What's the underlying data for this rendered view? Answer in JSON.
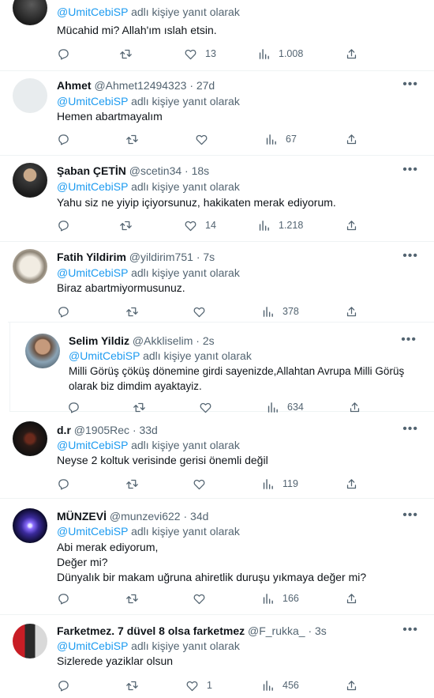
{
  "reply_prefix": "adlı kişiye yanıt olarak",
  "tweets": [
    {
      "name": "",
      "handle": "",
      "time": "",
      "mention": "@UmitCebiSP",
      "lines": [
        "Mücahid mi? Allah'ım ıslah etsin."
      ],
      "replies": "",
      "retweets": "",
      "likes": "13",
      "views": "1.008"
    },
    {
      "name": "Ahmet",
      "handle": "@Ahmet12494323",
      "time": "· 27d",
      "mention": "@UmitCebiSP",
      "lines": [
        "Hemen abartmayalım"
      ],
      "replies": "",
      "retweets": "",
      "likes": "",
      "views": "67"
    },
    {
      "name": "Şaban ÇETİN",
      "handle": "@scetin34",
      "time": "· 18s",
      "mention": "@UmitCebiSP",
      "lines": [
        "Yahu siz ne yiyip içiyorsunuz, hakikaten merak ediyorum."
      ],
      "replies": "",
      "retweets": "",
      "likes": "14",
      "views": "1.218"
    },
    {
      "name": "Fatih Yildirim",
      "handle": "@yildirim751",
      "time": "· 7s",
      "mention": "@UmitCebiSP",
      "lines": [
        "Biraz abartmiyormusunuz."
      ],
      "replies": "",
      "retweets": "",
      "likes": "",
      "views": "378"
    },
    {
      "name": "Selim Yildiz",
      "handle": "@Akkliselim",
      "time": "· 2s",
      "mention": "@UmitCebiSP",
      "lines": [
        "Milli Görüş çöküş dönemine girdi sayenizde,Allahtan Avrupa Milli Görüş",
        "olarak biz dimdim ayaktayiz."
      ],
      "replies": "",
      "retweets": "",
      "likes": "",
      "views": "634"
    },
    {
      "name": "d.r",
      "handle": "@1905Rec",
      "time": "· 33d",
      "mention": "@UmitCebiSP",
      "lines": [
        "Neyse 2 koltuk verisinde gerisi önemli değil"
      ],
      "replies": "",
      "retweets": "",
      "likes": "",
      "views": "119"
    },
    {
      "name": "MÜNZEVİ",
      "handle": "@munzevi622",
      "time": "· 34d",
      "mention": "@UmitCebiSP",
      "lines": [
        "Abi merak ediyorum,",
        "Değer mi?",
        "Dünyalık bir makam uğruna ahiretlik duruşu yıkmaya değer mi?"
      ],
      "replies": "",
      "retweets": "",
      "likes": "",
      "views": "166"
    },
    {
      "name": "Farketmez. 7 düvel 8 olsa farketmez",
      "handle": "@F_rukka_",
      "time": "· 3s",
      "mention": "@UmitCebiSP",
      "lines": [
        "Sizlerede yaziklar olsun"
      ],
      "replies": "",
      "retweets": "",
      "likes": "1",
      "views": "456"
    }
  ],
  "colors": {
    "link": "#1d9bf0",
    "secondary": "#536471",
    "text": "#0f1419",
    "border": "#eff3f4"
  }
}
